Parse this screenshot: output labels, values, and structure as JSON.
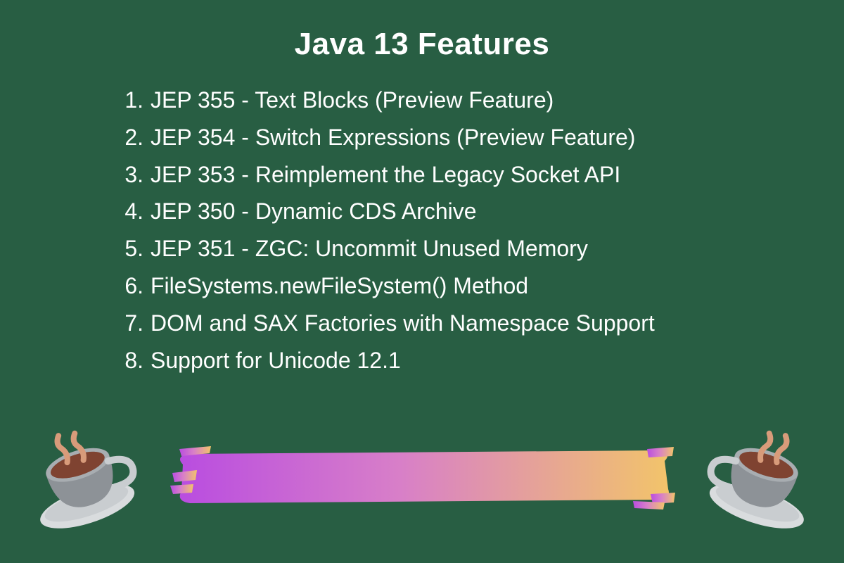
{
  "title": "Java 13 Features",
  "items": [
    "JEP 355 - Text Blocks (Preview Feature)",
    "JEP 354 - Switch Expressions (Preview Feature)",
    "JEP 353 - Reimplement the Legacy Socket API",
    "JEP 350 - Dynamic CDS Archive",
    "JEP 351 - ZGC: Uncommit Unused Memory",
    "FileSystems.newFileSystem() Method",
    "DOM and SAX Factories with Namespace Support",
    "Support for Unicode 12.1"
  ],
  "colors": {
    "background": "#285e43",
    "text": "#ffffff",
    "brush_gradient": [
      "#b94de0",
      "#d87fc8",
      "#f2c46a"
    ]
  }
}
